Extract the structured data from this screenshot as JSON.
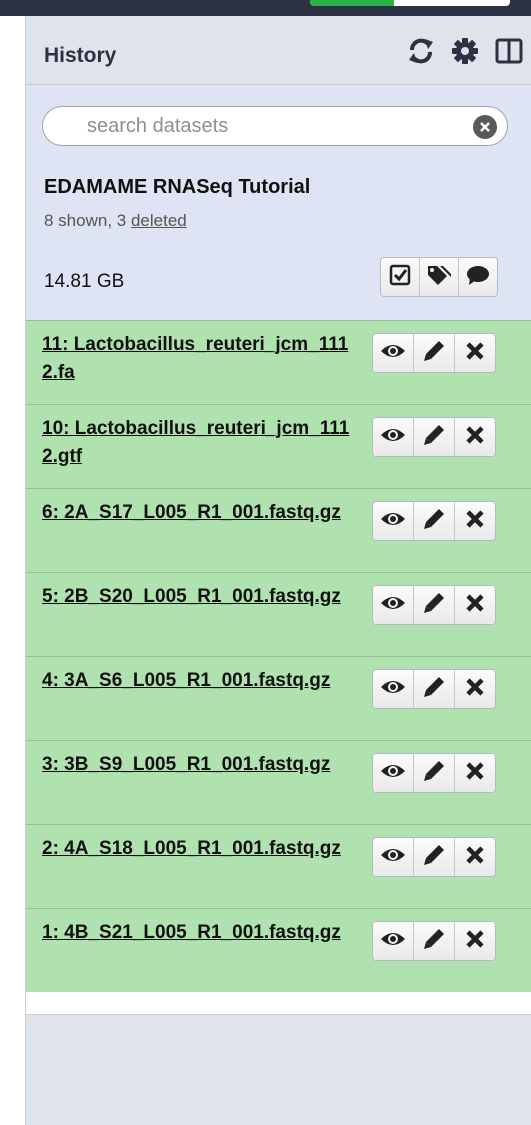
{
  "panel": {
    "title": "History"
  },
  "header_icons": [
    "refresh-icon",
    "gear-icon",
    "columns-icon"
  ],
  "search": {
    "placeholder": "search datasets",
    "value": ""
  },
  "history": {
    "name": "EDAMAME RNASeq Tutorial",
    "shown_text": "8 shown, 3 ",
    "deleted_link": "deleted",
    "size": "14.81 GB",
    "actions": [
      "checkbox-icon",
      "tags-icon",
      "comment-icon"
    ]
  },
  "datasets": [
    {
      "title": "11: Lactobacillus_reuteri_jcm_1112.fa"
    },
    {
      "title": "10: Lactobacillus_reuteri_jcm_1112.gtf"
    },
    {
      "title": "6: 2A_S17_L005_R1_001.fastq.gz"
    },
    {
      "title": "5: 2B_S20_L005_R1_001.fastq.gz"
    },
    {
      "title": "4: 3A_S6_L005_R1_001.fastq.gz"
    },
    {
      "title": "3: 3B_S9_L005_R1_001.fastq.gz"
    },
    {
      "title": "2: 4A_S18_L005_R1_001.fastq.gz"
    },
    {
      "title": "1: 4B_S21_L005_R1_001.fastq.gz"
    }
  ],
  "dataset_actions": [
    "eye-icon",
    "pencil-icon",
    "close-icon"
  ],
  "colors": {
    "dataset_ok_bg": "#b0e2b0",
    "history_bg": "#dfe4f4",
    "panel_header_bg": "#dfe3ea",
    "masthead_bg": "#2c3143",
    "masthead_accent": "#2bb34a"
  }
}
